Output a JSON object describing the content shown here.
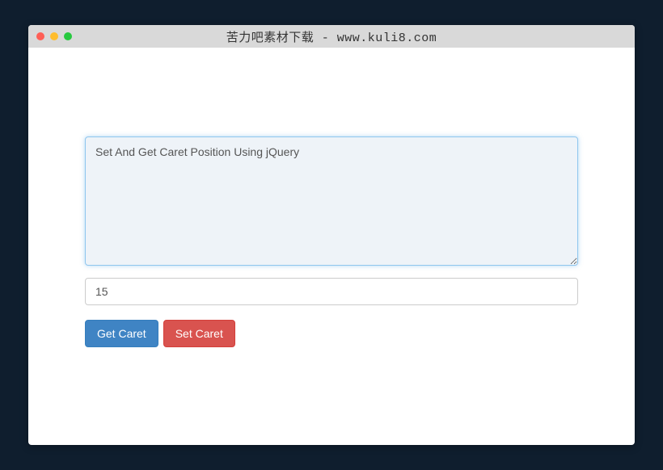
{
  "window": {
    "title": "苦力吧素材下载 - www.kuli8.com"
  },
  "form": {
    "textarea_value": "Set And Get Caret Position Using jQuery",
    "input_value": "15",
    "get_caret_label": "Get Caret",
    "set_caret_label": "Set Caret"
  },
  "colors": {
    "background": "#0f1e2e",
    "primary": "#3f84c4",
    "danger": "#d9534f",
    "textarea_focus_bg": "#eef3f8",
    "textarea_focus_border": "#8fc6ee"
  }
}
